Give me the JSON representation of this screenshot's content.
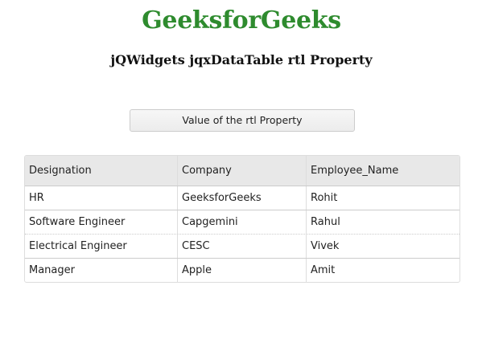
{
  "header": {
    "site_title": "GeeksforGeeks",
    "subtitle": "jQWidgets jqxDataTable rtl Property"
  },
  "button": {
    "label": "Value of the rtl Property"
  },
  "table": {
    "columns": [
      "Designation",
      "Company",
      "Employee_Name"
    ],
    "rows": [
      [
        "HR",
        "GeeksforGeeks",
        "Rohit"
      ],
      [
        "Software Engineer",
        "Capgemini",
        "Rahul"
      ],
      [
        "Electrical Engineer",
        "CESC",
        "Vivek"
      ],
      [
        "Manager",
        "Apple",
        "Amit"
      ]
    ]
  },
  "colors": {
    "title_green": "#2e8b2e",
    "header_bg": "#e8e8e8"
  }
}
